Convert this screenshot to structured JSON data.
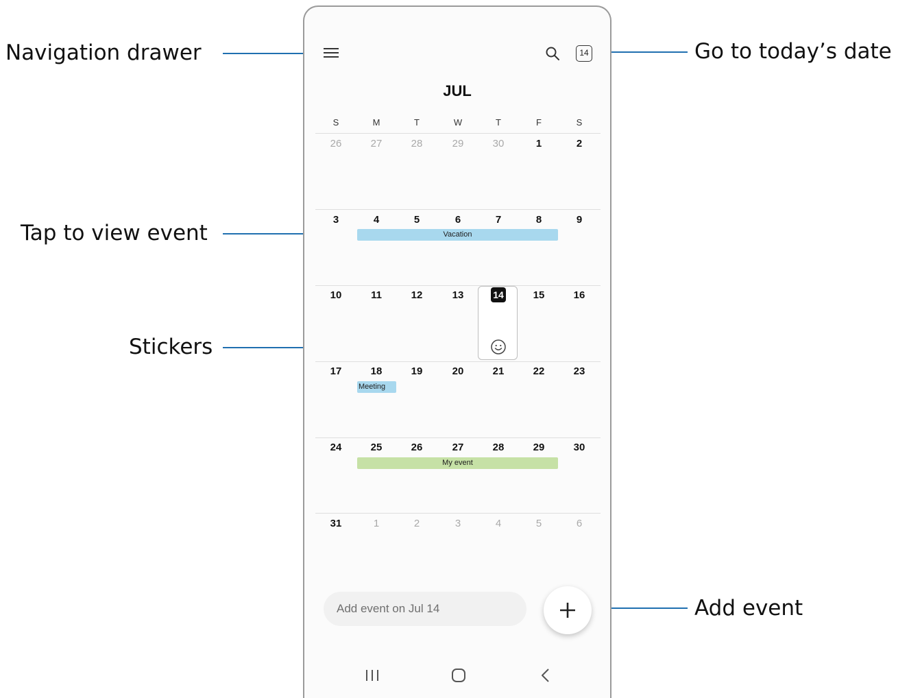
{
  "callouts": {
    "navigation_drawer": "Navigation drawer",
    "go_to_today": "Go to today’s date",
    "tap_to_view_event": "Tap to view event",
    "stickers": "Stickers",
    "add_event": "Add event"
  },
  "header": {
    "menu_icon": "menu-icon",
    "search_icon": "search-icon",
    "today_badge": "14"
  },
  "month": "JUL",
  "weekdays": [
    "S",
    "M",
    "T",
    "W",
    "T",
    "F",
    "S"
  ],
  "weeks": [
    [
      "26",
      "27",
      "28",
      "29",
      "30",
      "1",
      "2"
    ],
    [
      "3",
      "4",
      "5",
      "6",
      "7",
      "8",
      "9"
    ],
    [
      "10",
      "11",
      "12",
      "13",
      "14",
      "15",
      "16"
    ],
    [
      "17",
      "18",
      "19",
      "20",
      "21",
      "22",
      "23"
    ],
    [
      "24",
      "25",
      "26",
      "27",
      "28",
      "29",
      "30"
    ],
    [
      "31",
      "1",
      "2",
      "3",
      "4",
      "5",
      "6"
    ]
  ],
  "today": "14",
  "events": {
    "vacation": "Vacation",
    "meeting": "Meeting",
    "my_event": "My event"
  },
  "colors": {
    "vacation": "#a8d8ee",
    "meeting": "#a8d8ee",
    "my_event": "#c6e1a6",
    "callout_line": "#1f6fb0"
  },
  "add_event": {
    "placeholder": "Add event on Jul 14",
    "fab_icon": "plus-icon"
  },
  "navbar": {
    "recents_icon": "recents-icon",
    "home_icon": "home-icon",
    "back_icon": "back-icon"
  }
}
